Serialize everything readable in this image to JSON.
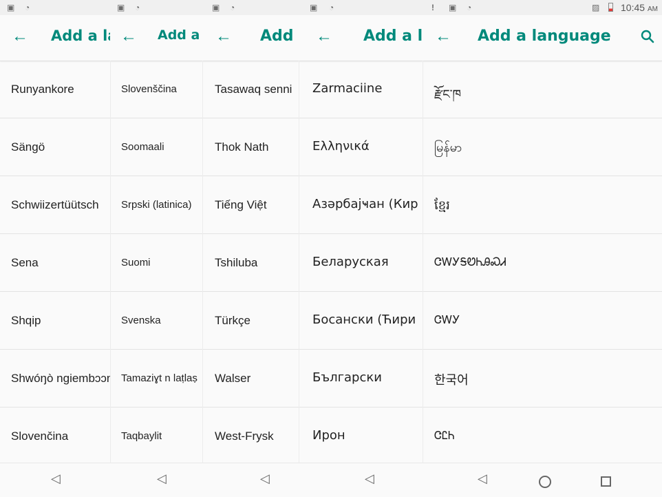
{
  "status": {
    "time": "10:45",
    "ampm": "AM"
  },
  "title": "Add a language",
  "panels": [
    {
      "title_visible": "Add a lan",
      "items": [
        "Runyankore",
        "Sängö",
        "Schwiizertüütsch",
        "Sena",
        "Shqip",
        "Shwóŋò ngiembɔɔn",
        "Slovenčina"
      ]
    },
    {
      "title_visible": "Add a la",
      "items": [
        "Slovenščina",
        "Soomaali",
        "Srpski (latinica)",
        "Suomi",
        "Svenska",
        "Tamaziɣt n laṭlaṣ",
        "Taqbaylit"
      ]
    },
    {
      "title_visible": "Add a",
      "items": [
        "Tasawaq senni",
        "Thok Nath",
        "Tiếng Việt",
        "Tshiluba",
        "Türkçe",
        "Walser",
        "West-Frysk"
      ]
    },
    {
      "title_visible": "Add a la",
      "items": [
        "Zarmaciine",
        "Ελληνικά",
        "Азәрбајҹан (Кир",
        "Беларуская",
        "Босански (Ћири",
        "Български",
        "Ирон"
      ]
    },
    {
      "title_visible": "Add a language",
      "items": [
        "རྫོང་ཁ",
        "မြန်မာ",
        "ខ្មែរ",
        "ᏣᎳᎩᎦᏬᏂᎯᏍᏗ",
        "ᏣᎳᎩ",
        "한국어",
        "ᏣᏝᏂ"
      ]
    }
  ]
}
